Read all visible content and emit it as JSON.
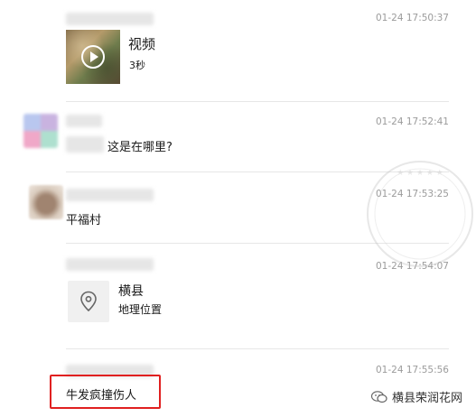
{
  "messages": [
    {
      "time": "01-24 17:50:37",
      "type": "video",
      "title": "视频",
      "duration": "3秒"
    },
    {
      "time": "01-24 17:52:41",
      "type": "text",
      "text": "这是在哪里?"
    },
    {
      "time": "01-24 17:53:25",
      "type": "text",
      "text": "平福村"
    },
    {
      "time": "01-24 17:54:07",
      "type": "location",
      "title": "横县",
      "subtitle": "地理位置"
    },
    {
      "time": "01-24 17:55:56",
      "type": "text",
      "text": "牛发疯撞伤人"
    }
  ],
  "footer": {
    "brand": "横县荣润花网"
  },
  "colors": {
    "highlight": "#e02020",
    "time": "#9b9b9b"
  }
}
